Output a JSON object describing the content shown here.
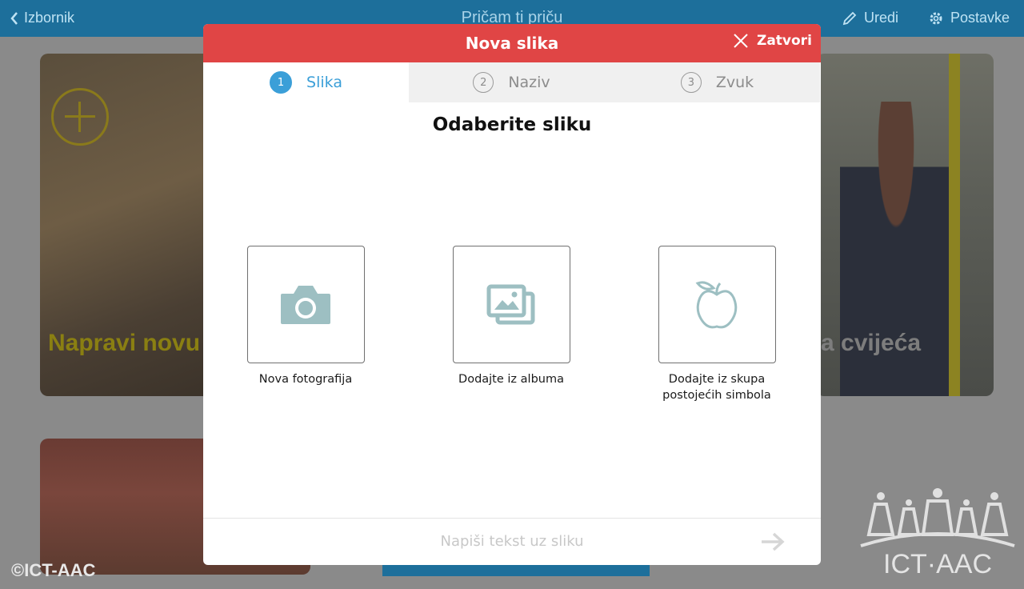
{
  "topbar": {
    "back_label": "Izbornik",
    "title": "Pričam ti priču",
    "edit_label": "Uredi",
    "settings_label": "Postavke"
  },
  "background_cards": {
    "card1_caption": "Napravi novu p",
    "card2_caption": "a cvijeća"
  },
  "watermark": {
    "copyright": "©ICT-AAC",
    "logo_text": "ICT·AAC"
  },
  "modal": {
    "title": "Nova slika",
    "close_label": "Zatvori",
    "tabs": [
      {
        "number": "1",
        "label": "Slika"
      },
      {
        "number": "2",
        "label": "Naziv"
      },
      {
        "number": "3",
        "label": "Zvuk"
      }
    ],
    "heading": "Odaberite sliku",
    "options": [
      {
        "label": "Nova fotografija",
        "icon": "camera-icon"
      },
      {
        "label": "Dodajte iz albuma",
        "icon": "photo-album-icon"
      },
      {
        "label_line1": "Dodajte iz skupa",
        "label_line2": "postojećih simbola",
        "icon": "apple-icon"
      }
    ],
    "footer_text": "Napiši tekst uz sliku"
  },
  "colors": {
    "header_red": "#e04545",
    "accent_blue": "#3b9fd8",
    "icon_teal": "#9dbfc2",
    "topbar_blue": "#1d6f9b"
  }
}
